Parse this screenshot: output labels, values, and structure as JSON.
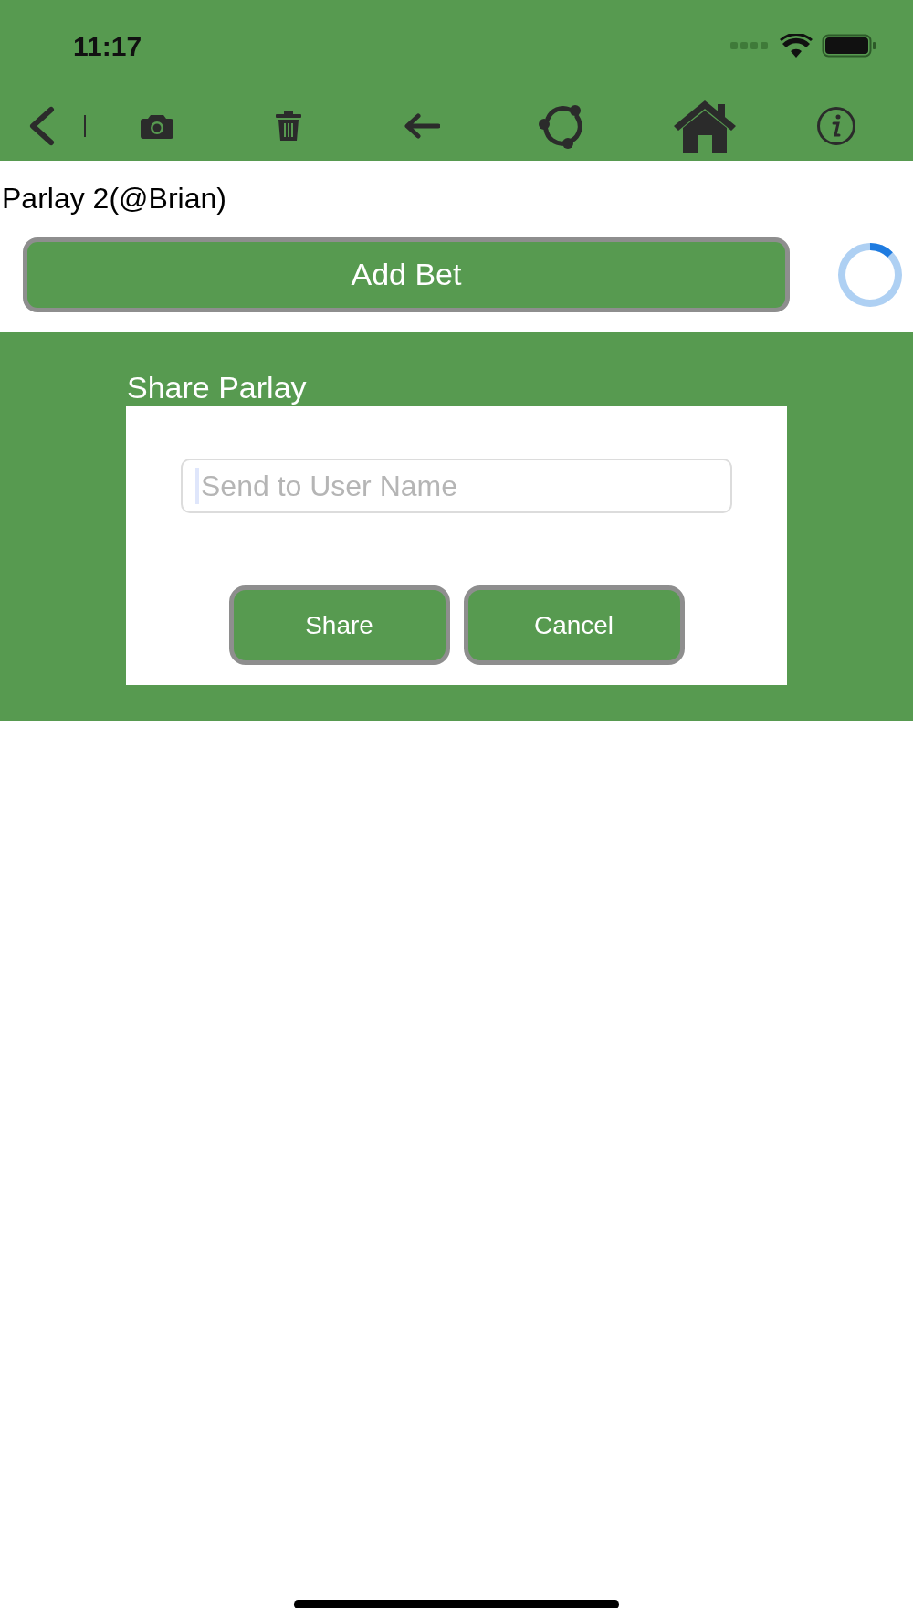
{
  "status_bar": {
    "time": "11:17"
  },
  "page": {
    "title": "Parlay 2(@Brian)",
    "add_button": "Add Bet"
  },
  "share_dialog": {
    "title": "Share Parlay",
    "field": {
      "placeholder": "Send to User Name",
      "focused": true
    },
    "buttons": [
      "Share",
      "Cancel"
    ]
  }
}
